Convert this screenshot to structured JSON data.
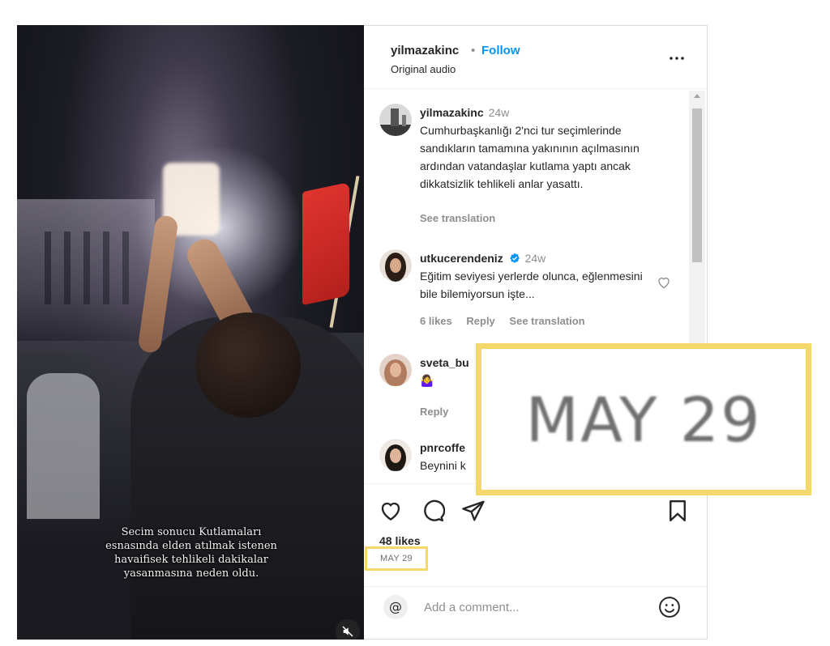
{
  "video": {
    "caption_lines": [
      "Secim sonucu Kutlamaları",
      "esnasında elden atılmak istenen",
      "havaifisek tehlikeli dakikalar",
      "yasanmasına neden oldu."
    ],
    "mute_icon": "speaker-muted-icon"
  },
  "header": {
    "username": "yilmazakinc",
    "separator": "•",
    "follow_label": "Follow",
    "subtitle": "Original audio",
    "more_icon": "more-options-icon"
  },
  "comments": [
    {
      "username": "yilmazakinc",
      "time": "24w",
      "text": "Cumhurbaşkanlığı 2'nci tur seçimlerinde sandıkların tamamına yakınının açılmasının ardından vatandaşlar kutlama yaptı ancak dikkatsizlik tehlikeli anlar yasattı.",
      "see_translation": "See translation"
    },
    {
      "username": "utkucerendeniz",
      "verified": true,
      "time": "24w",
      "text": "Eğitim seviyesi yerlerde olunca, eğlenmesini bile bilemiyorsun işte...",
      "likes": "6 likes",
      "reply": "Reply",
      "see_translation": "See translation"
    },
    {
      "username": "sveta_bu",
      "text": "🤷‍♀️",
      "reply": "Reply"
    },
    {
      "username": "pnrcoffe",
      "text": "Beynini k"
    }
  ],
  "actions": {
    "like_icon": "heart-icon",
    "comment_icon": "comment-icon",
    "share_icon": "send-icon",
    "save_icon": "bookmark-icon",
    "likes_count": "48 likes",
    "date": "MAY 29"
  },
  "add_comment": {
    "placeholder": "Add a comment...",
    "emoji_icon": "emoji-icon"
  },
  "zoom_callout": {
    "text": "MAY 29",
    "border_color": "#f5d86b"
  },
  "colors": {
    "accent": "#0095f6",
    "highlight": "#f5d86b",
    "muted_text": "#8e8e8e"
  }
}
